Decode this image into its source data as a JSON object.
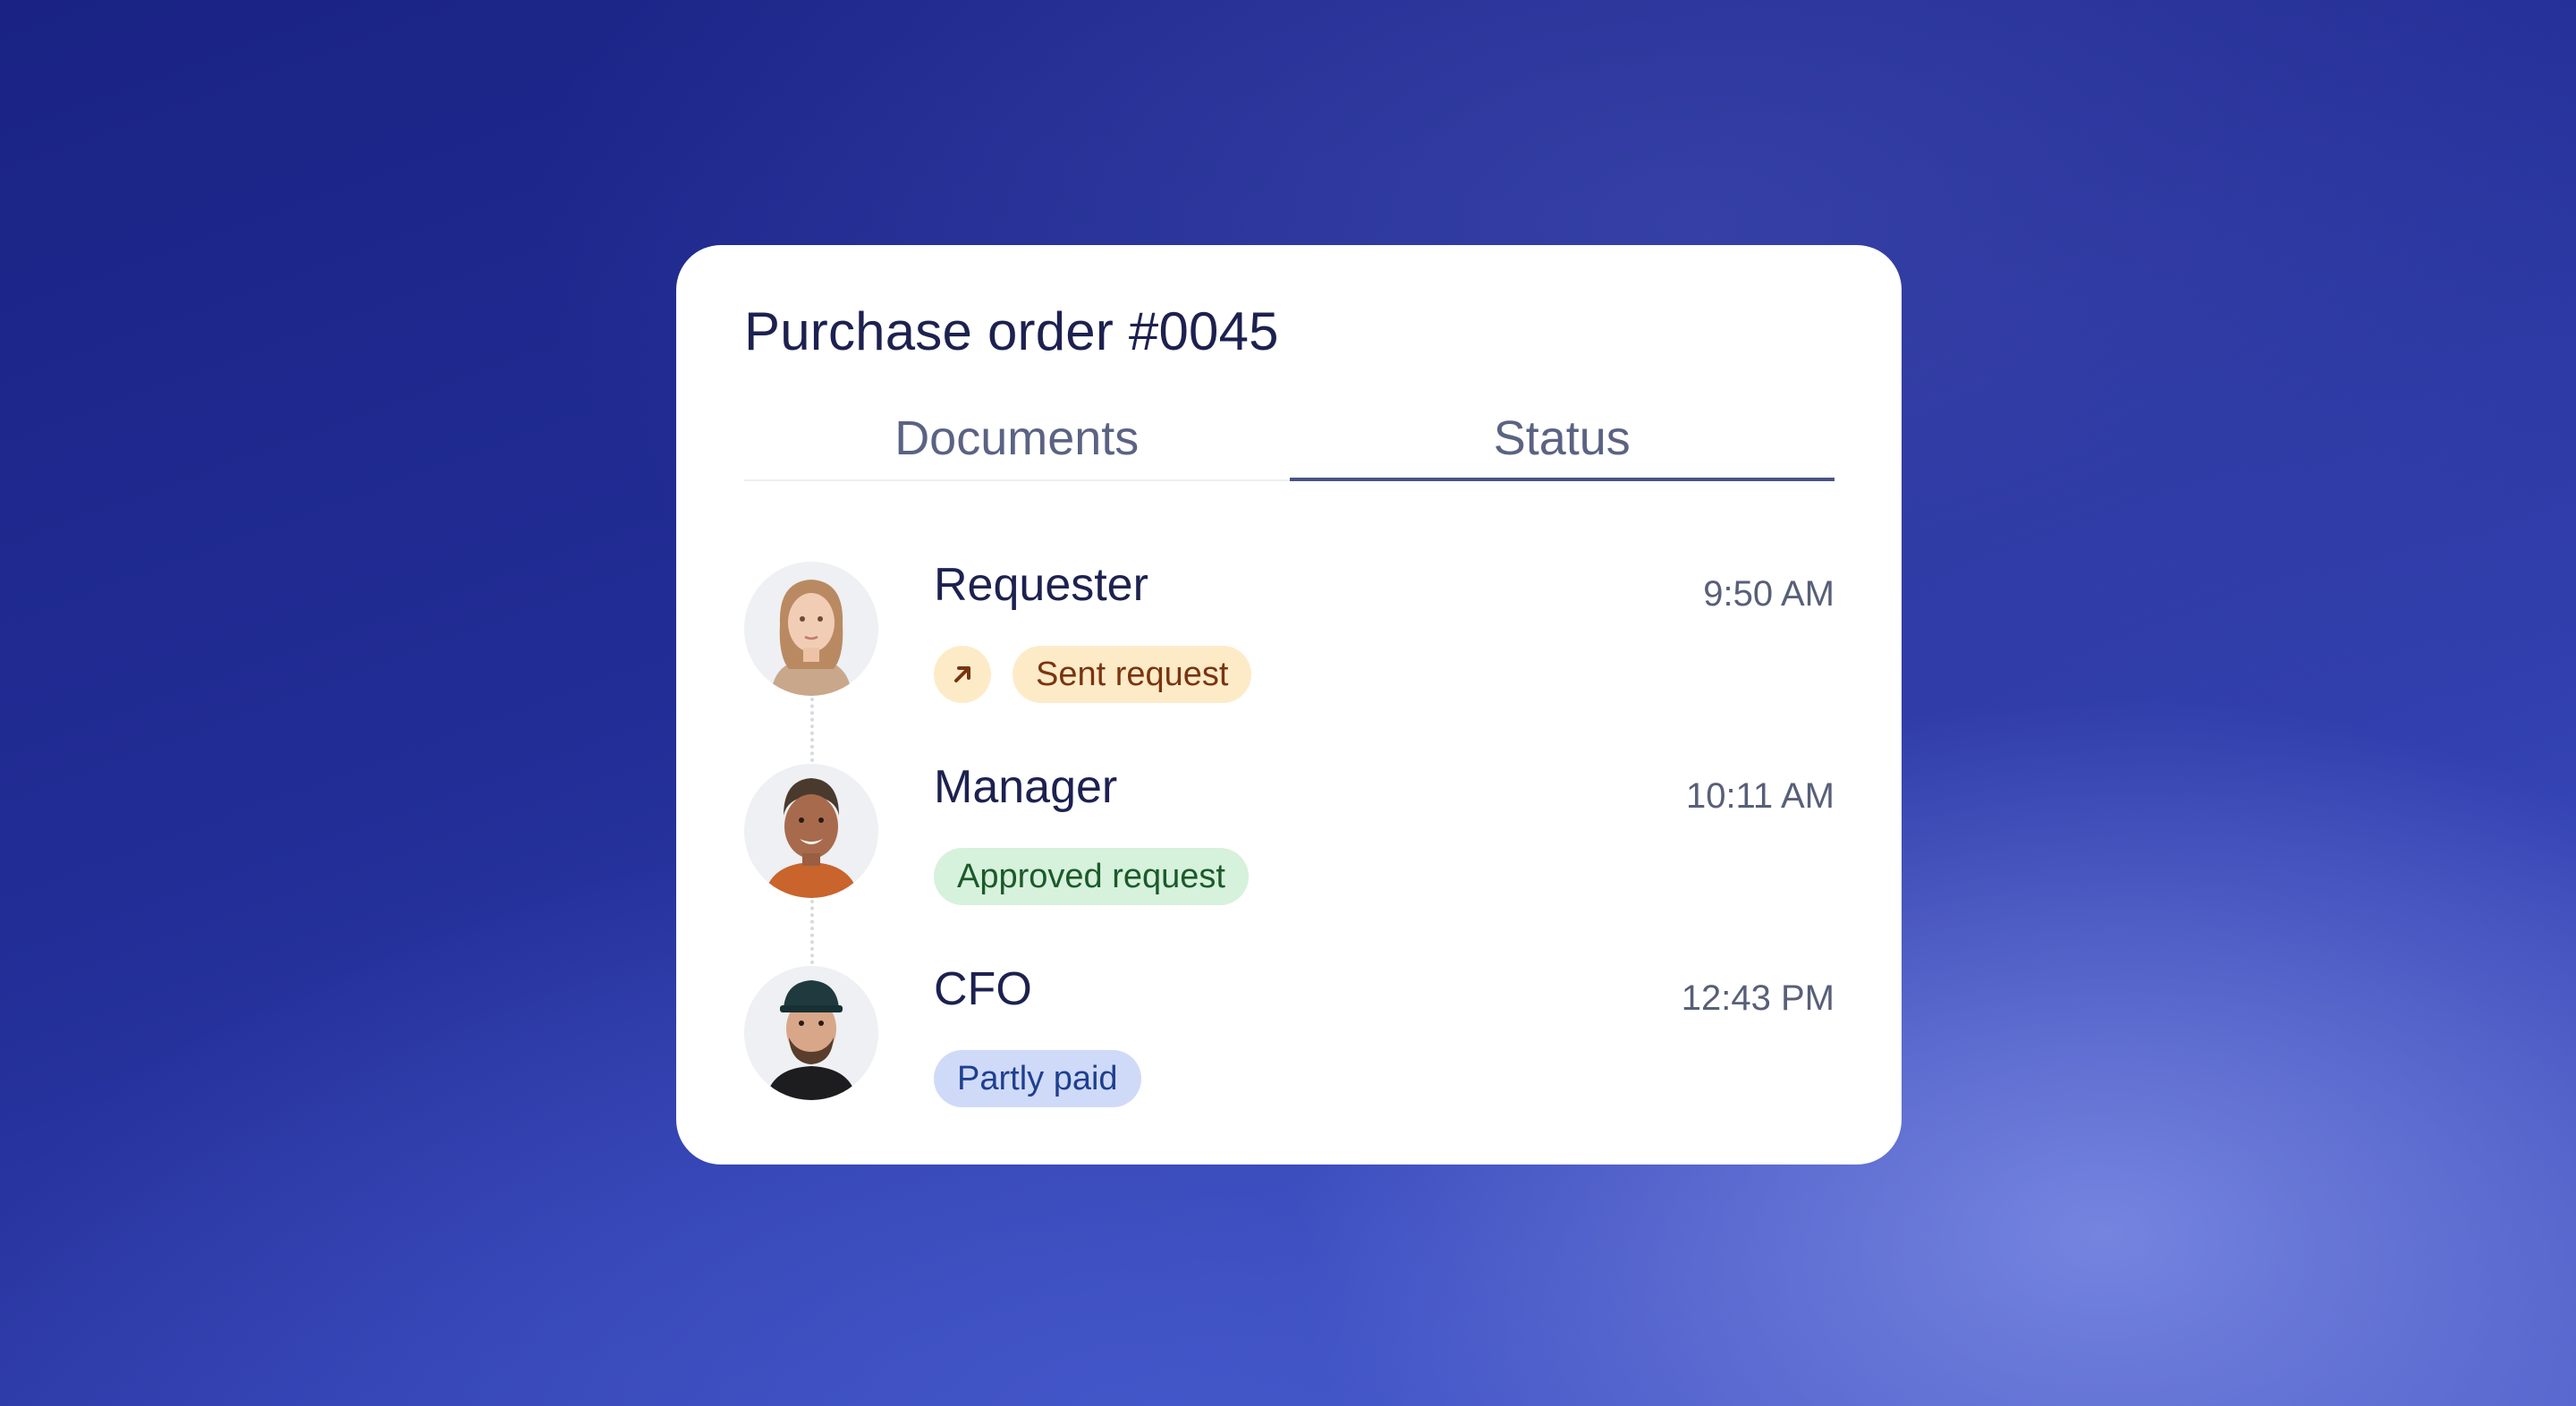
{
  "card": {
    "title": "Purchase order #0045"
  },
  "tabs": [
    {
      "label": "Documents",
      "active": false
    },
    {
      "label": "Status",
      "active": true
    }
  ],
  "timeline": [
    {
      "role": "Requester",
      "time": "9:50 AM",
      "status": "Sent request",
      "status_icon": "arrow-up-right-icon",
      "status_color": "#fdebc8"
    },
    {
      "role": "Manager",
      "time": "10:11 AM",
      "status": "Approved request",
      "status_color": "#d6f1dc"
    },
    {
      "role": "CFO",
      "time": "12:43 PM",
      "status": "Partly paid",
      "status_color": "#cfdaf9"
    }
  ],
  "colors": {
    "active_tab_underline": "#4b5286",
    "text_primary": "#1d2150",
    "background_accent": "#222d96"
  }
}
